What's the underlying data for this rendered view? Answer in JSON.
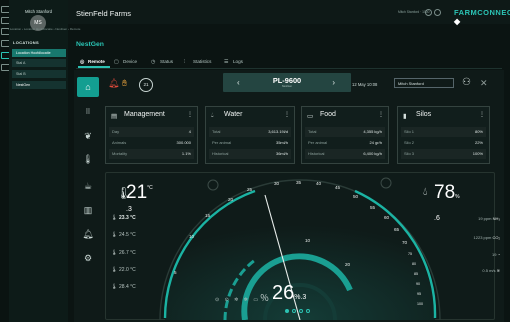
{
  "sidebar": {
    "user_name": "Mitch Stanford",
    "avatar_initials": "MS",
    "section_title": "LOCATIONS",
    "items": [
      {
        "label": "Location Hoofdlocatie",
        "active": true
      },
      {
        "label": "Stal A",
        "active": false
      },
      {
        "label": "Stal B",
        "active": false
      },
      {
        "label": "NestGen",
        "active": false
      }
    ]
  },
  "header": {
    "brand": "StienFeld Farms",
    "user_line": "Mitch Stanford  ·  1000",
    "logo_main": "FARMCONNECT",
    "breadcrumb": "›  Location  ›  Location Hoofdlocatie  ›  NestGen  ›  Remote"
  },
  "page": {
    "title": "NestGen",
    "tabs": [
      {
        "label": "Remote",
        "active": true
      },
      {
        "label": "Device",
        "active": false
      },
      {
        "label": "Status",
        "active": false
      },
      {
        "label": "Statistics",
        "active": false
      },
      {
        "label": "Logs",
        "active": false
      }
    ]
  },
  "devicebar": {
    "alarm_count": "21",
    "device_name": "PL-9600",
    "device_sub": "NestGen",
    "date": "12 May 10:08",
    "user": "Mitch Stanford"
  },
  "cards": {
    "management": {
      "title": "Management",
      "rows": [
        {
          "k": "Day",
          "v": "4"
        },
        {
          "k": "Animals",
          "v": "300.000"
        },
        {
          "k": "Mortality",
          "v": "1.1%"
        }
      ]
    },
    "water": {
      "title": "Water",
      "rows": [
        {
          "k": "Total",
          "v": "3,613.19l/d"
        },
        {
          "k": "Per animal",
          "v": "35ml/h"
        },
        {
          "k": "Historical",
          "v": "36ml/h"
        }
      ]
    },
    "food": {
      "title": "Food",
      "rows": [
        {
          "k": "Total",
          "v": "4,355 kg/h"
        },
        {
          "k": "Per animal",
          "v": "24 gr/h"
        },
        {
          "k": "Historical",
          "v": "6,400 kg/h"
        }
      ]
    },
    "silos": {
      "title": "Silos",
      "rows": [
        {
          "k": "Silo 1",
          "v": "80%"
        },
        {
          "k": "Silo 2",
          "v": "22%"
        },
        {
          "k": "Silo 3",
          "v": "100%"
        }
      ]
    }
  },
  "gauge": {
    "temp_main": "21",
    "temp_dec": ".3",
    "temp_unit": "°C",
    "hum_main": "78",
    "hum_dec": ".6",
    "hum_unit": "%",
    "center_main": "26",
    "center_dec": ".3",
    "center_unit": "%",
    "sensors": [
      "23.3 °C",
      "24.5 °C",
      "26.7 °C",
      "22.0 °C",
      "28.4 °C"
    ],
    "right_stats": [
      {
        "value": "19 ppm",
        "unit": "NH₃"
      },
      {
        "value": "1223 ppm",
        "unit": "CO₂"
      },
      {
        "value": "19",
        "unit": ""
      },
      {
        "value": "0.5 m/s",
        "unit": ""
      }
    ],
    "outer_ticks": [
      "5",
      "10",
      "15",
      "20",
      "25",
      "30",
      "35",
      "40",
      "45",
      "50",
      "55",
      "60",
      "65",
      "70",
      "75",
      "80",
      "85",
      "90",
      "95",
      "100"
    ],
    "inner_ticks": [
      "10",
      "20"
    ]
  }
}
